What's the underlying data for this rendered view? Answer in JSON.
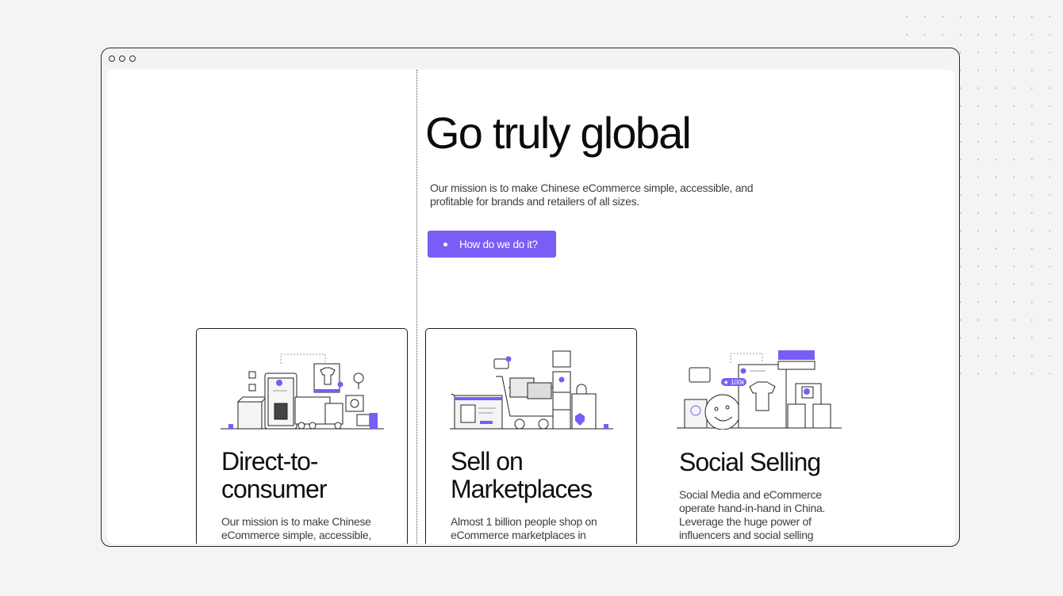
{
  "hero": {
    "title": "Go truly global",
    "text": "Our mission is to make Chinese eCommerce simple, accessible, and profitable for brands and retailers of all sizes.",
    "cta_label": "How do we do it?"
  },
  "cards": [
    {
      "title": "Direct-to-consumer",
      "desc": "Our mission is to make Chinese eCommerce simple, accessible,",
      "illustration": "delivery-illustration"
    },
    {
      "title": "Sell on Marketplaces",
      "desc": "Almost 1 billion people shop on eCommerce marketplaces in",
      "illustration": "shopping-cart-illustration"
    },
    {
      "title": "Social Selling",
      "desc": "Social Media and eCommerce operate hand-in-hand in China. Leverage the huge power of influencers and social selling",
      "illustration": "social-media-illustration",
      "badge": "★ 100k"
    }
  ],
  "colors": {
    "accent": "#7a5cf6",
    "background": "#f4f4f4"
  }
}
